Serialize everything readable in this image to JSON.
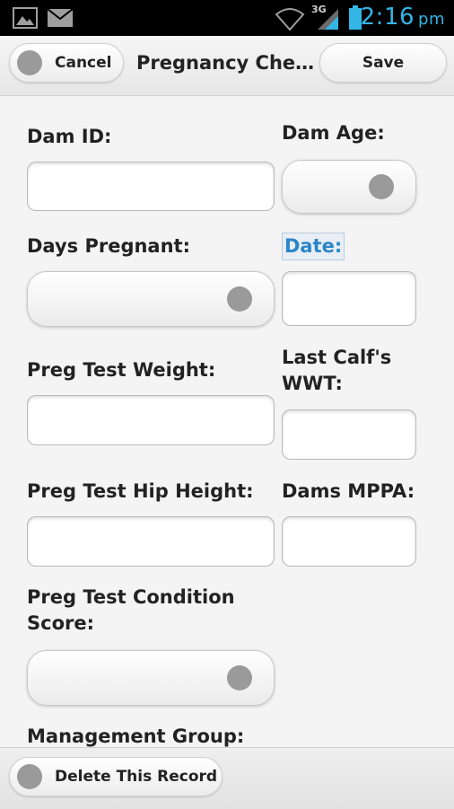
{
  "status_bar": {
    "time": "2:16",
    "ampm": "pm",
    "network": "3G",
    "icons": [
      "gallery-icon",
      "mail-icon",
      "wifi-icon",
      "signal-icon",
      "battery-icon"
    ]
  },
  "header": {
    "cancel_label": "Cancel",
    "title": "Pregnancy Chec…",
    "save_label": "Save"
  },
  "form": {
    "dam_id": {
      "label": "Dam ID:",
      "value": ""
    },
    "dam_age": {
      "label": "Dam Age:",
      "value": ""
    },
    "days_pregnant": {
      "label": "Days Pregnant:",
      "value": ""
    },
    "date": {
      "label": "Date:",
      "value": ""
    },
    "preg_test_weight": {
      "label": "Preg Test Weight:",
      "value": ""
    },
    "last_calf_wwt": {
      "label_line1": "Last Calf's",
      "label_line2": "WWT:",
      "value": ""
    },
    "preg_test_hip_height": {
      "label": "Preg Test Hip Height:",
      "value": ""
    },
    "dams_mppa": {
      "label": "Dams MPPA:",
      "value": ""
    },
    "preg_test_condition_score": {
      "label_line1": "Preg Test Condition",
      "label_line2": "Score:",
      "value": ""
    },
    "management_group": {
      "label": "Management Group:"
    }
  },
  "footer": {
    "delete_label": "Delete This Record"
  },
  "colors": {
    "accent": "#33b5e5",
    "link_label": "#2a86c8",
    "status_bar_bg": "#000000"
  }
}
